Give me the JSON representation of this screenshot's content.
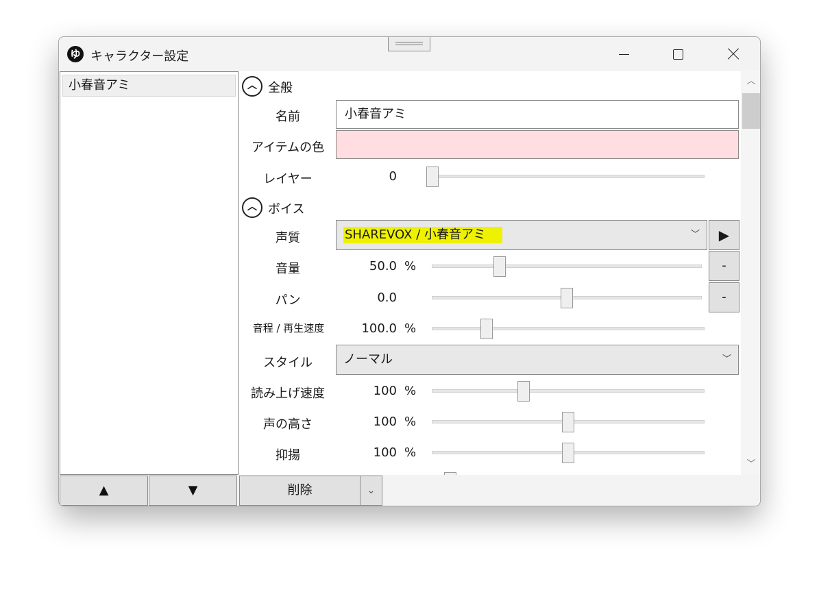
{
  "window": {
    "title": "キャラクター設定",
    "app_icon_glyph": "ゆ"
  },
  "list": {
    "items": [
      "小春音アミ"
    ]
  },
  "buttons": {
    "up": "▲",
    "down": "▼",
    "delete": "削除",
    "delete_dropdown": "⌄"
  },
  "general": {
    "header": "全般",
    "name_label": "名前",
    "name_value": "小春音アミ",
    "item_color_label": "アイテムの色",
    "item_color": "#ffdde0",
    "layer_label": "レイヤー",
    "layer_value": "0"
  },
  "voice": {
    "header": "ボイス",
    "quality_label": "声質",
    "quality_value": "SHAREVOX / 小春音アミ",
    "play_glyph": "▶",
    "volume_label": "音量",
    "volume_value": "50.0",
    "volume_unit": "%",
    "pan_label": "パン",
    "pan_value": "0.0",
    "pitch_label": "音程 / 再生速度",
    "pitch_value": "100.0",
    "pitch_unit": "%",
    "style_label": "スタイル",
    "style_value": "ノーマル",
    "reading_speed_label": "読み上げ速度",
    "reading_speed_value": "100",
    "reading_speed_unit": "%",
    "voice_pitch_label": "声の高さ",
    "voice_pitch_value": "100",
    "voice_pitch_unit": "%",
    "intonation_label": "抑揚",
    "intonation_value": "100",
    "intonation_unit": "%",
    "minus_glyph": "-"
  },
  "sliders": {
    "layer": 0.0,
    "volume": 0.25,
    "pan": 0.5,
    "pitch": 0.2,
    "reading_speed": 0.335,
    "voice_pitch": 0.5,
    "intonation": 0.5
  },
  "highlight_color": "#eef100"
}
